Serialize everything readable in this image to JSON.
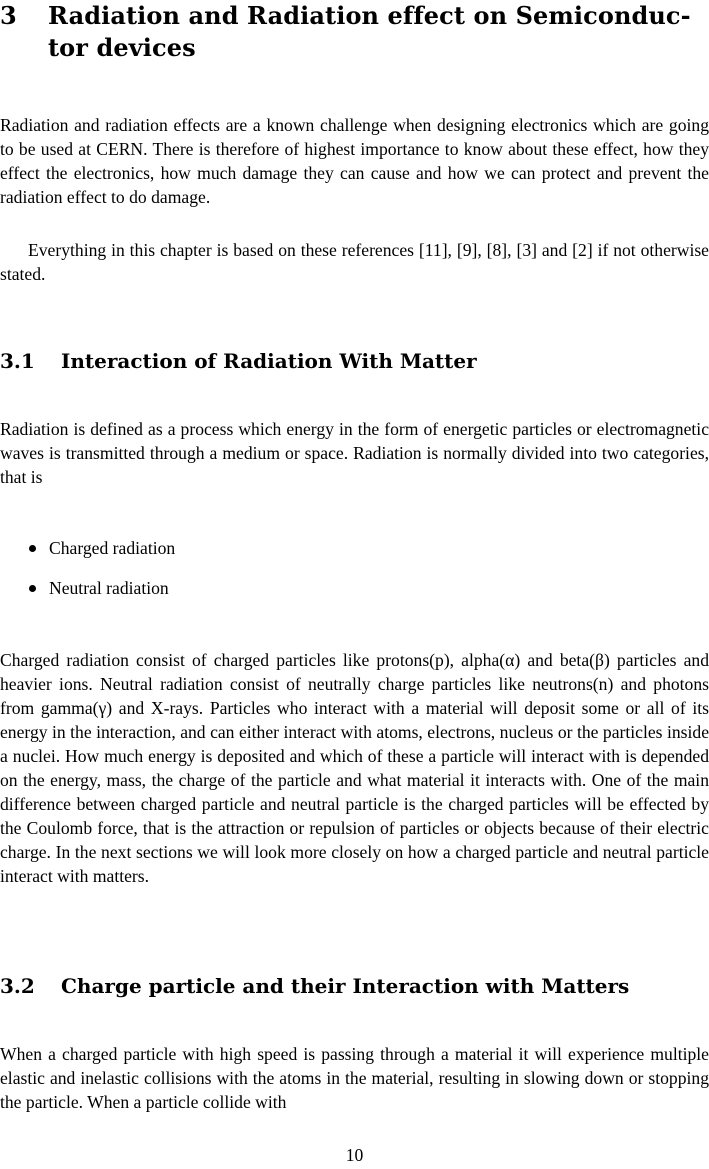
{
  "section": {
    "number": "3",
    "title": "Radiation and Radiation effect on Semiconduc-tor devices"
  },
  "intro_paragraphs": [
    "Radiation and radiation effects are a known challenge when designing electronics which are going to be used at CERN. There is therefore of highest importance to know about these effect, how they effect the electronics, how much damage they can cause and how we can protect and prevent the radiation effect to do damage.",
    "Everything in this chapter is based on these references [11], [9], [8], [3] and [2] if not otherwise stated."
  ],
  "subsection_1": {
    "number": "3.1",
    "title": "Interaction of Radiation With Matter",
    "paragraph_1": "Radiation is defined as a process which energy in the form of energetic particles or electromagnetic waves is transmitted through a medium or space. Radiation is normally divided into two categories, that is",
    "bullets": [
      "Charged radiation",
      "Neutral radiation"
    ],
    "paragraph_2": "Charged radiation consist of charged particles like protons(p), alpha(α) and beta(β) particles and heavier ions. Neutral radiation consist of neutrally charge particles like neutrons(n) and photons from gamma(γ) and X-rays. Particles who interact with a material will deposit some or all of its energy in the interaction, and can either interact with atoms, electrons, nucleus or the particles inside a nuclei. How much energy is deposited and which of these a particle will interact with is depended on the energy, mass, the charge of the particle and what material it interacts with. One of the main difference between charged particle and neutral particle is the charged particles will be effected by the Coulomb force, that is the attraction or repulsion of particles or objects because of their electric charge. In the next sections we will look more closely on how a charged particle and neutral particle interact with matters."
  },
  "subsection_2": {
    "number": "3.2",
    "title": "Charge particle and their Interaction with Matters",
    "paragraph_1": "When a charged particle with high speed is passing through a material it will experience multiple elastic and inelastic collisions with the atoms in the material, resulting in slowing down or stopping the particle. When a particle collide with"
  },
  "page_number": "10"
}
